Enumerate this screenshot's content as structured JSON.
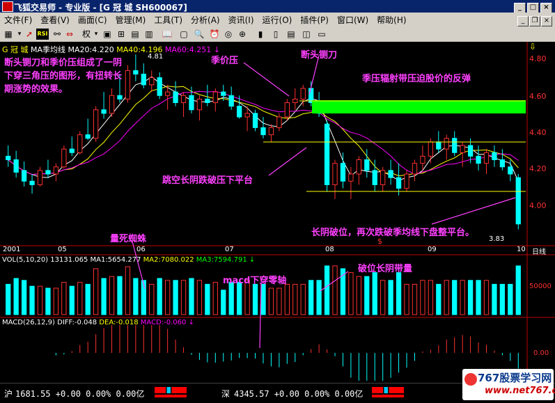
{
  "window": {
    "title": "飞狐交易师 - 专业版 - [G 冠  城 SH600067]",
    "min": "_",
    "max": "□",
    "close": "×",
    "mdi_min": "_",
    "mdi_restore": "❐",
    "mdi_close": "×"
  },
  "menu": [
    "文件(F)",
    "查看(V)",
    "画面(C)",
    "管理(M)",
    "工具(T)",
    "分析(A)",
    "资讯(I)",
    "运行(O)",
    "插件(P)",
    "窗口(W)",
    "帮助(H)"
  ],
  "toolbar": {
    "icons": [
      "chart-icon",
      "dropdown-icon",
      "arrow-up-icon",
      "rsi-icon",
      "link-icon",
      "swap-icon",
      "right-angle-icon",
      "dropdown-icon",
      "screen-icon",
      "grid-icon",
      "grid2-icon",
      "book-icon",
      "window-icon",
      "magnify-icon",
      "alarm-icon",
      "binoculars-icon",
      "zoom-in-icon",
      "zoom-out-icon",
      "bars-icon",
      "volume-icon",
      "table-icon",
      "split-icon",
      "picture-icon"
    ],
    "rsi_label": "RSI",
    "right_label": "权"
  },
  "main_chart": {
    "indicator_header": {
      "stock": "G 冠  城",
      "ma_name": "MA季均线",
      "ma20": "MA20:4.220",
      "ma40": "MA40:4.196",
      "ma60": "MA60:4.251",
      "down_arrow": "↓"
    },
    "price_labels": [
      "4.80",
      "4.60",
      "4.40",
      "4.20",
      "4.00"
    ],
    "high_label": "4.81",
    "low_label": "3.83",
    "timeaxis": [
      "2001",
      "05",
      "06",
      "07",
      "08",
      "09",
      "10"
    ],
    "dayline_label": "日线",
    "scroll_marker": "$",
    "annotations": {
      "left_note": "断头铡刀和季价压组成了一阴下穿三角压的图形，有扭转长期涨势的效果。",
      "jijia": "季价压",
      "duantou": "断头铡刀",
      "jiya": "季压辐射带压迫股价的反弹",
      "tiaokong": "跳空长阴跌破压下平台",
      "changyin": "长阴破位，再次跌破季均线下盘整平台。"
    },
    "colors": {
      "up": "#00ffff",
      "down": "#00ffff",
      "upbody": "#ff3030",
      "ma20": "#ffffff",
      "ma40": "#ffff00",
      "ma60": "#ff00ff",
      "annot": "#ff40ff",
      "band": "#00ff00"
    }
  },
  "vol_panel": {
    "header": {
      "name": "VOL(5,10,20)",
      "val": "13131.065",
      "ma1": "MA1:5654.277",
      "ma2": "MA2:7080.022",
      "ma3": "MA3:7594.791",
      "arrow": "↓"
    },
    "scale": "50000",
    "annotations": {
      "liangsi": "量死蜘蛛",
      "macd_cross": "macd下穿零轴",
      "poweiyin": "破位长阴带量"
    }
  },
  "macd_panel": {
    "header": {
      "name": "MACD(26,12,9)",
      "diff": "DIFF:-0.048",
      "dea": "DEA:-0.018",
      "macd": "MACD:-0.060",
      "arrow": "↓"
    },
    "scale": "0.00"
  },
  "status": {
    "sh_label": "沪",
    "sh_value": "1681.55 +0.00 0.00% 0.00亿",
    "sz_label": "深",
    "sz_value": "4345.57 +0.00 0.00% 0.00亿"
  },
  "watermark": {
    "main": "767股票学习网",
    "sub": "www.net767.com"
  },
  "chart_data": {
    "type": "candlestick",
    "ylim": [
      3.75,
      4.85
    ],
    "candles": [
      [
        4.24,
        4.3,
        4.18,
        4.22
      ],
      [
        4.22,
        4.27,
        4.12,
        4.15
      ],
      [
        4.16,
        4.21,
        4.07,
        4.1
      ],
      [
        4.1,
        4.14,
        4.03,
        4.08
      ],
      [
        4.08,
        4.18,
        4.07,
        4.16
      ],
      [
        4.16,
        4.22,
        4.12,
        4.14
      ],
      [
        4.14,
        4.2,
        4.1,
        4.18
      ],
      [
        4.18,
        4.3,
        4.17,
        4.28
      ],
      [
        4.28,
        4.35,
        4.24,
        4.26
      ],
      [
        4.26,
        4.38,
        4.25,
        4.36
      ],
      [
        4.36,
        4.45,
        4.33,
        4.34
      ],
      [
        4.34,
        4.52,
        4.32,
        4.5
      ],
      [
        4.5,
        4.6,
        4.45,
        4.48
      ],
      [
        4.48,
        4.62,
        4.46,
        4.58
      ],
      [
        4.58,
        4.7,
        4.54,
        4.56
      ],
      [
        4.56,
        4.75,
        4.54,
        4.72
      ],
      [
        4.72,
        4.81,
        4.66,
        4.7
      ],
      [
        4.7,
        4.76,
        4.62,
        4.64
      ],
      [
        4.64,
        4.72,
        4.6,
        4.68
      ],
      [
        4.68,
        4.71,
        4.56,
        4.58
      ],
      [
        4.58,
        4.64,
        4.5,
        4.6
      ],
      [
        4.6,
        4.66,
        4.52,
        4.54
      ],
      [
        4.54,
        4.6,
        4.46,
        4.58
      ],
      [
        4.58,
        4.63,
        4.48,
        4.5
      ],
      [
        4.5,
        4.58,
        4.44,
        4.56
      ],
      [
        4.56,
        4.64,
        4.52,
        4.54
      ],
      [
        4.54,
        4.62,
        4.49,
        4.6
      ],
      [
        4.6,
        4.64,
        4.55,
        4.58
      ],
      [
        4.58,
        4.63,
        4.5,
        4.52
      ],
      [
        4.52,
        4.58,
        4.45,
        4.46
      ],
      [
        4.46,
        4.52,
        4.38,
        4.48
      ],
      [
        4.48,
        4.5,
        4.38,
        4.4
      ],
      [
        4.4,
        4.46,
        4.34,
        4.36
      ],
      [
        4.36,
        4.42,
        4.32,
        4.4
      ],
      [
        4.4,
        4.48,
        4.38,
        4.46
      ],
      [
        4.46,
        4.56,
        4.44,
        4.54
      ],
      [
        4.54,
        4.62,
        4.5,
        4.56
      ],
      [
        4.56,
        4.64,
        4.52,
        4.62
      ],
      [
        4.62,
        4.66,
        4.52,
        4.54
      ],
      [
        4.54,
        4.6,
        4.46,
        4.48
      ],
      [
        4.42,
        4.44,
        4.04,
        4.08
      ],
      [
        4.08,
        4.22,
        4.0,
        4.2
      ],
      [
        4.2,
        4.26,
        4.06,
        4.1
      ],
      [
        4.1,
        4.18,
        4.0,
        4.14
      ],
      [
        4.14,
        4.24,
        4.08,
        4.22
      ],
      [
        4.22,
        4.28,
        4.12,
        4.16
      ],
      [
        4.16,
        4.22,
        4.04,
        4.08
      ],
      [
        4.08,
        4.18,
        4.04,
        4.16
      ],
      [
        4.16,
        4.22,
        4.08,
        4.12
      ],
      [
        4.12,
        4.2,
        4.02,
        4.06
      ],
      [
        4.06,
        4.16,
        4.04,
        4.14
      ],
      [
        4.14,
        4.22,
        4.1,
        4.2
      ],
      [
        4.2,
        4.3,
        4.16,
        4.24
      ],
      [
        4.24,
        4.34,
        4.2,
        4.32
      ],
      [
        4.32,
        4.38,
        4.26,
        4.28
      ],
      [
        4.28,
        4.36,
        4.22,
        4.34
      ],
      [
        4.34,
        4.38,
        4.24,
        4.26
      ],
      [
        4.26,
        4.32,
        4.18,
        4.3
      ],
      [
        4.3,
        4.34,
        4.2,
        4.24
      ],
      [
        4.24,
        4.3,
        4.16,
        4.2
      ],
      [
        4.2,
        4.28,
        4.14,
        4.26
      ],
      [
        4.26,
        4.3,
        4.18,
        4.22
      ],
      [
        4.22,
        4.28,
        4.16,
        4.18
      ],
      [
        4.18,
        4.22,
        4.1,
        4.14
      ],
      [
        4.12,
        4.14,
        3.83,
        3.86
      ]
    ]
  }
}
